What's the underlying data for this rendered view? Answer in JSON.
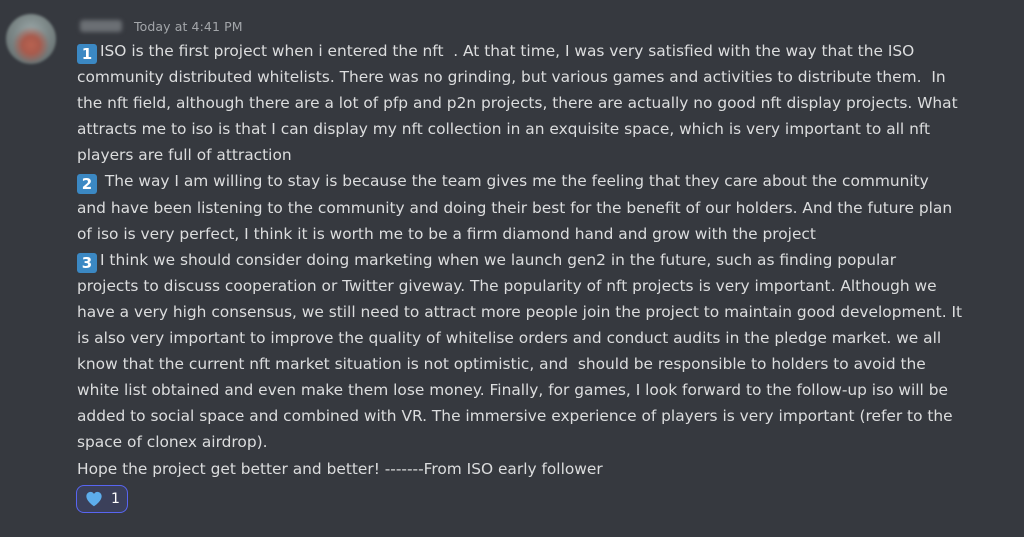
{
  "message": {
    "timestamp": "Today at 4:41 PM",
    "lines": [
      {
        "badge": "1",
        "text": "ISO is the first project when i entered the nft  . At that time, I was very satisfied with the way that the ISO"
      },
      {
        "badge": null,
        "text": "community distributed whitelists. There was no grinding, but various games and activities to distribute them.  In"
      },
      {
        "badge": null,
        "text": "the nft field, although there are a lot of pfp and p2n projects, there are actually no good nft display projects. What"
      },
      {
        "badge": null,
        "text": "attracts me to iso is that I can display my nft collection in an exquisite space, which is very important to all nft"
      },
      {
        "badge": null,
        "text": "players are full of attraction"
      },
      {
        "badge": "2",
        "text": " The way I am willing to stay is because the team gives me the feeling that they care about the community"
      },
      {
        "badge": null,
        "text": "and have been listening to the community and doing their best for the benefit of our holders. And the future plan"
      },
      {
        "badge": null,
        "text": "of iso is very perfect, I think it is worth me to be a firm diamond hand and grow with the project"
      },
      {
        "badge": "3",
        "text": "I think we should consider doing marketing when we launch gen2 in the future, such as finding popular"
      },
      {
        "badge": null,
        "text": "projects to discuss cooperation or Twitter giveway. The popularity of nft projects is very important. Although we"
      },
      {
        "badge": null,
        "text": "have a very high consensus, we still need to attract more people join the project to maintain good development. It"
      },
      {
        "badge": null,
        "text": "is also very important to improve the quality of whitelise orders and conduct audits in the pledge market. we all"
      },
      {
        "badge": null,
        "text": "know that the current nft market situation is not optimistic, and  should be responsible to holders to avoid the"
      },
      {
        "badge": null,
        "text": "white list obtained and even make them lose money. Finally, for games, I look forward to the follow-up iso will be"
      },
      {
        "badge": null,
        "text": "added to social space and combined with VR. The immersive experience of players is very important (refer to the"
      },
      {
        "badge": null,
        "text": "space of clonex airdrop)."
      },
      {
        "badge": null,
        "text": "Hope the project get better and better! -------From ISO early follower"
      }
    ]
  },
  "reaction": {
    "icon": "blue-heart-icon",
    "count": "1",
    "color": "#5865f2"
  }
}
